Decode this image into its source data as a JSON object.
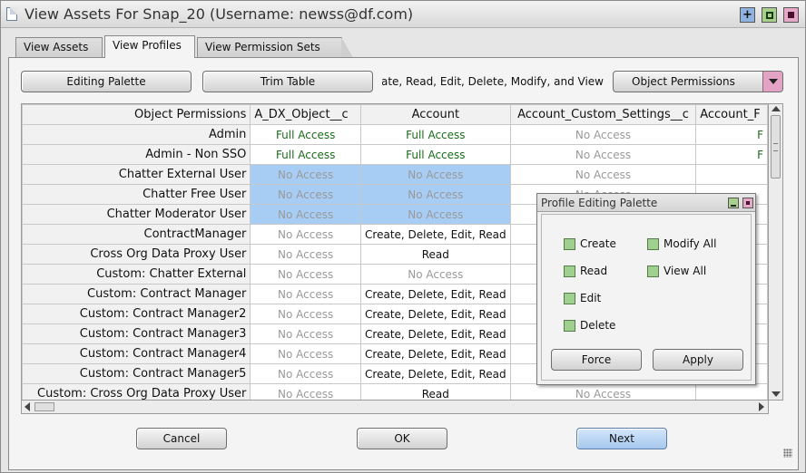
{
  "window": {
    "title": "View Assets For Snap_20 (Username: newss@df.com)"
  },
  "tabs": [
    {
      "label": "View Assets",
      "active": false
    },
    {
      "label": "View Profiles",
      "active": true
    },
    {
      "label": "View Permission Sets",
      "active": false
    }
  ],
  "toolbar": {
    "editing_palette_label": "Editing Palette",
    "trim_table_label": "Trim Table",
    "legend_text": "Create, Read, Edit, Delete, Modify, and View",
    "permission_type_selected": "Object Permissions"
  },
  "table": {
    "columns": [
      "Object Permissions",
      "A_DX_Object__c",
      "Account",
      "Account_Custom_Settings__c",
      "Account_F"
    ],
    "rows": [
      {
        "name": "Admin",
        "cells": [
          "Full Access",
          "Full Access",
          "No Access",
          "F"
        ]
      },
      {
        "name": "Admin - Non SSO",
        "cells": [
          "Full Access",
          "Full Access",
          "No Access",
          "F"
        ]
      },
      {
        "name": "Chatter External User",
        "cells": [
          "No Access",
          "No Access",
          "No Access",
          ""
        ]
      },
      {
        "name": "Chatter Free User",
        "cells": [
          "No Access",
          "No Access",
          "No Access",
          ""
        ]
      },
      {
        "name": "Chatter Moderator User",
        "cells": [
          "No Access",
          "No Access",
          "",
          ""
        ]
      },
      {
        "name": "ContractManager",
        "cells": [
          "No Access",
          "Create, Delete, Edit, Read",
          "",
          ""
        ]
      },
      {
        "name": "Cross Org Data Proxy User",
        "cells": [
          "No Access",
          "Read",
          "",
          ""
        ]
      },
      {
        "name": "Custom: Chatter External",
        "cells": [
          "No Access",
          "No Access",
          "",
          ""
        ]
      },
      {
        "name": "Custom: Contract Manager",
        "cells": [
          "No Access",
          "Create, Delete, Edit, Read",
          "",
          ""
        ]
      },
      {
        "name": "Custom: Contract Manager2",
        "cells": [
          "No Access",
          "Create, Delete, Edit, Read",
          "",
          ""
        ]
      },
      {
        "name": "Custom: Contract Manager3",
        "cells": [
          "No Access",
          "Create, Delete, Edit, Read",
          "",
          ""
        ]
      },
      {
        "name": "Custom: Contract Manager4",
        "cells": [
          "No Access",
          "Create, Delete, Edit, Read",
          "",
          ""
        ]
      },
      {
        "name": "Custom: Contract Manager5",
        "cells": [
          "No Access",
          "Create, Delete, Edit, Read",
          "",
          ""
        ]
      },
      {
        "name": "Custom: Cross Org Data Proxy User",
        "cells": [
          "No Access",
          "Read",
          "No Access",
          ""
        ]
      }
    ]
  },
  "palette": {
    "title": "Profile Editing Palette",
    "checkboxes": [
      "Create",
      "Read",
      "Edit",
      "Delete",
      "Modify All",
      "View All"
    ],
    "force_label": "Force",
    "apply_label": "Apply"
  },
  "footer": {
    "cancel_label": "Cancel",
    "ok_label": "OK",
    "next_label": "Next"
  },
  "colors": {
    "full_access": "#1a6b1a",
    "no_access": "#999999",
    "selection": "#a8cdf5",
    "next_button": "#a7c8ee",
    "dropdown_arrow": "#e2a3c4"
  }
}
